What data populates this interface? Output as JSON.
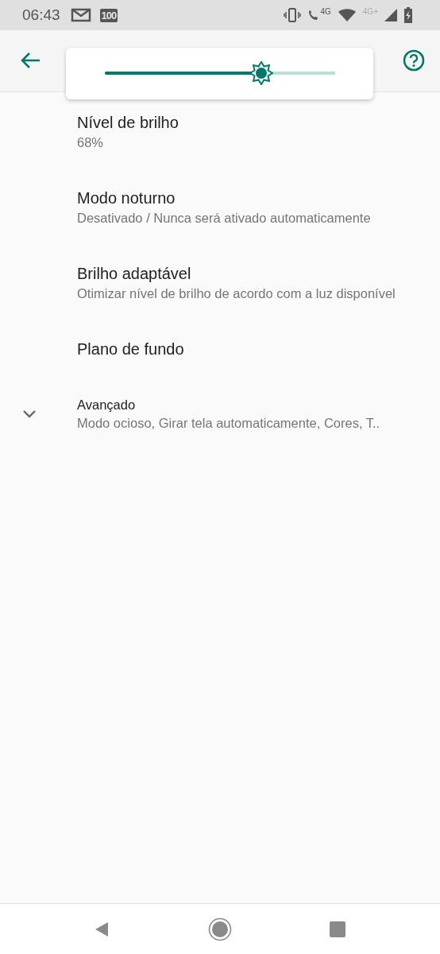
{
  "status_bar": {
    "time": "06:43",
    "notification_badge": "100",
    "call_network": "4G",
    "mobile_network": "4G+"
  },
  "brightness_slider": {
    "level": 0.68
  },
  "items": [
    {
      "kind": "setting",
      "title": "Nível de brilho",
      "summary": "68%"
    },
    {
      "kind": "setting",
      "title": "Modo noturno",
      "summary": "Desativado / Nunca será ativado automaticamente"
    },
    {
      "kind": "setting",
      "title": "Brilho adaptável",
      "summary": "Otimizar nível de brilho de acordo com a luz disponível"
    },
    {
      "kind": "setting",
      "title": "Plano de fundo"
    },
    {
      "kind": "expander",
      "expanded": false,
      "title": "Avançado",
      "summary": "Modo ocioso, Girar tela automaticamente, Cores, T.."
    }
  ]
}
